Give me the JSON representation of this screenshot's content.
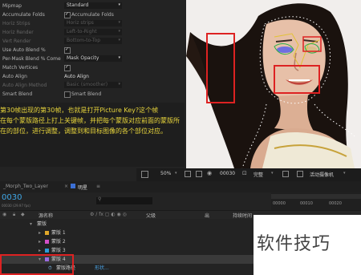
{
  "effect_controls": {
    "rows": [
      {
        "type": "dropdown",
        "label": "Mipmap",
        "value": "Standard",
        "dim": false
      },
      {
        "type": "checkbox",
        "label": "Accumulate Folds",
        "value": "Accumulate Folds",
        "checked": true,
        "dim": false
      },
      {
        "type": "dropdown",
        "label": "Horiz Strips",
        "value": "Horiz strips",
        "dim": true
      },
      {
        "type": "dropdown",
        "label": "Horiz Render",
        "value": "Left-to-Right",
        "dim": true
      },
      {
        "type": "dropdown",
        "label": "Vert Render",
        "value": "Bottom-to-Top",
        "dim": true
      },
      {
        "type": "checkbox",
        "label": "Use Auto Blend %",
        "value": "",
        "checked": true,
        "dim": false
      },
      {
        "type": "dropdown",
        "label": "Per-Mask Blend % Come",
        "value": "Mask Opacity",
        "dim": false
      },
      {
        "type": "checkbox",
        "label": "Match Vertices",
        "value": "",
        "checked": true,
        "dim": false
      },
      {
        "type": "text",
        "label": "Auto Align",
        "value": "Auto Align",
        "dim": false
      },
      {
        "type": "dropdown",
        "label": "Auto Align Method",
        "value": "Basic (smoother)",
        "dim": true
      },
      {
        "type": "checkbox",
        "label": "Smart Blend",
        "value": "Smart Blend",
        "checked": false,
        "dim": false
      }
    ]
  },
  "subtitle": {
    "lines": [
      "第30帧出现的第30帧，也就是打开Picture Key?这个帧",
      "在每个蒙版路径上打上关键帧，并把每个蒙版对应前面的蒙版所",
      "在的部位，进行调整，调整到和目标图像的各个部位对应。"
    ]
  },
  "viewer_toolbar": {
    "zoom": "50%",
    "timecode": "00030",
    "quality": "完整",
    "camera": "活动摄像机"
  },
  "timeline": {
    "tab_label": "明星",
    "panel_tab": "_Morph_Two_Layer",
    "timecode": "0030",
    "fps": "00030 (29.97 fps)",
    "col_name": "源名称",
    "col_parent": "父级",
    "col_out": "出",
    "col_duration": "持续时间",
    "ruler": [
      "00000",
      "00010",
      "00020"
    ],
    "group": "蒙版",
    "masks": [
      {
        "name": "蒙版 1",
        "color": "#e0a72a"
      },
      {
        "name": "蒙版 2",
        "color": "#d34fc8"
      },
      {
        "name": "蒙版 3",
        "color": "#2c9bd6"
      },
      {
        "name": "蒙版 4",
        "color": "#9a6be0"
      }
    ],
    "mask_path": "蒙版路径",
    "mask_path_value": "形状..."
  },
  "watermark": "软件技巧"
}
